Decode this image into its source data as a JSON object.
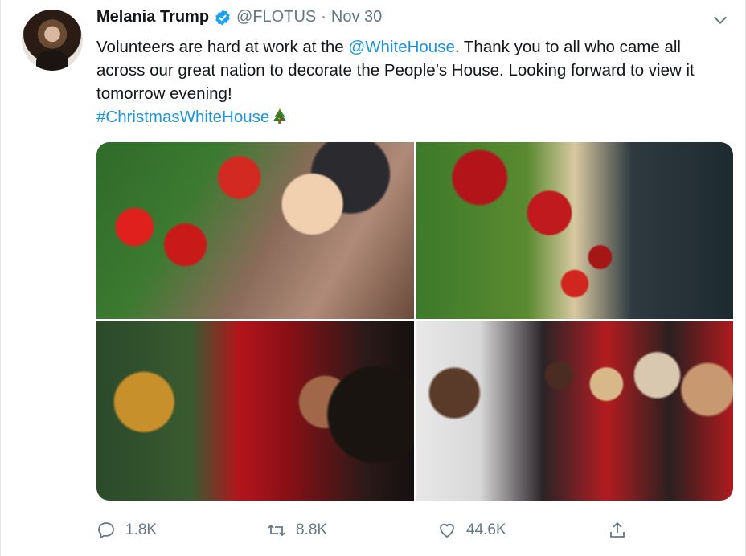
{
  "tweet": {
    "author_name": "Melania Trump",
    "handle": "@FLOTUS",
    "separator": "·",
    "date": "Nov 30",
    "text_part1": "Volunteers are hard at work at the ",
    "mention": "@WhiteHouse",
    "text_part2": ". Thank you to all who came all across our great nation to decorate the People’s House. Looking forward to view it tomorrow evening!",
    "hashtag": "#ChristmasWhiteHouse",
    "link_color": "#1b95e0"
  },
  "media": [
    {
      "alt": "volunteer-hanging-ornament"
    },
    {
      "alt": "volunteer-decorating-tree"
    },
    {
      "alt": "volunteer-decorating-wreath"
    },
    {
      "alt": "volunteers-group"
    }
  ],
  "actions": {
    "replies": "1.8K",
    "retweets": "8.8K",
    "likes": "44.6K"
  },
  "icons": [
    "verified-icon",
    "chevron-down-icon",
    "christmas-tree-emoji-icon",
    "reply-icon",
    "retweet-icon",
    "like-icon",
    "share-icon"
  ]
}
